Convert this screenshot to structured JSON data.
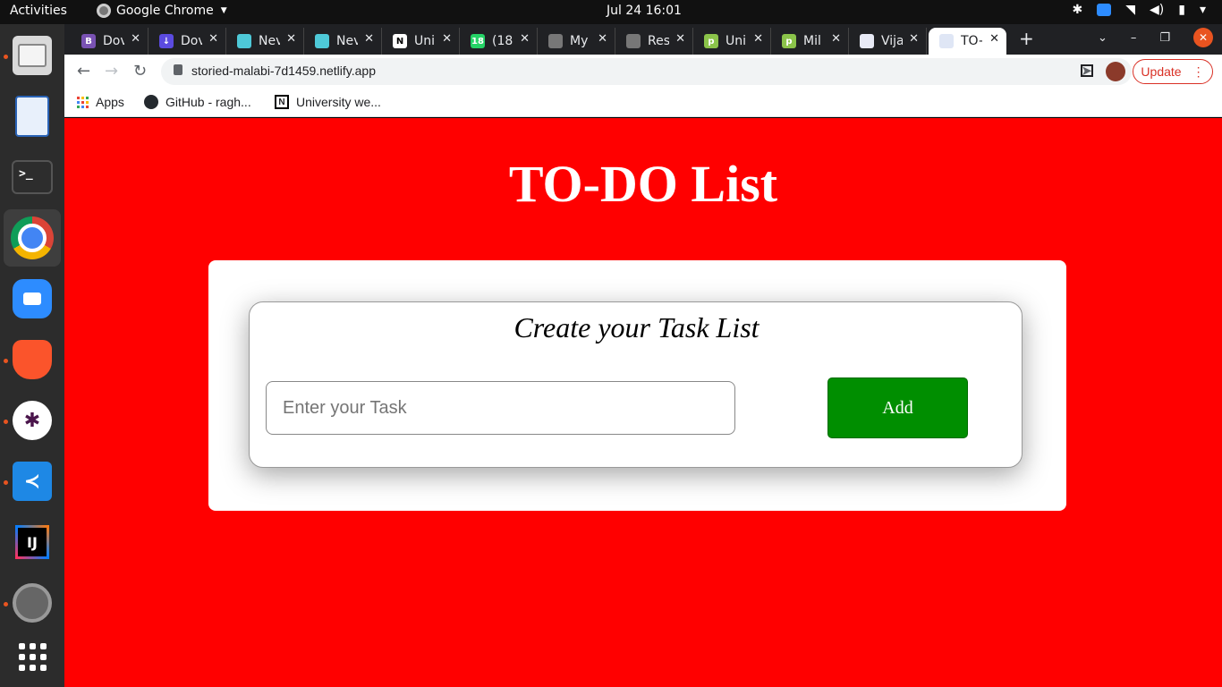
{
  "topbar": {
    "activities": "Activities",
    "app_name": "Google Chrome",
    "clock": "Jul 24  16:01"
  },
  "dock": {
    "items": [
      "files-icon",
      "libreoffice-writer-icon",
      "terminal-icon",
      "chrome-icon",
      "zoom-icon",
      "brave-icon",
      "slack-icon",
      "vscode-icon",
      "intellij-icon",
      "settings-icon",
      "show-apps-icon"
    ],
    "terminal_glyph": ">_",
    "intellij_glyph": "IJ"
  },
  "tabs": [
    {
      "title": "Dov",
      "favicon": "bootstrap-icon",
      "color": "#7952b3",
      "glyph": "B"
    },
    {
      "title": "Dov",
      "favicon": "download-icon",
      "color": "#5b4be0",
      "glyph": "↓"
    },
    {
      "title": "Nev",
      "favicon": "brand-icon",
      "color": "#4ec9d8",
      "glyph": ""
    },
    {
      "title": "Nev",
      "favicon": "brand-icon",
      "color": "#4ec9d8",
      "glyph": ""
    },
    {
      "title": "Uni",
      "favicon": "notion-icon",
      "color": "#ffffff",
      "glyph": "N"
    },
    {
      "title": "(18)",
      "favicon": "whatsapp-icon",
      "color": "#25d366",
      "glyph": "18"
    },
    {
      "title": "My",
      "favicon": "globe-icon",
      "color": "#777777",
      "glyph": ""
    },
    {
      "title": "Res",
      "favicon": "globe-icon",
      "color": "#777777",
      "glyph": ""
    },
    {
      "title": "Uni",
      "favicon": "p-icon",
      "color": "#8bc34a",
      "glyph": "p"
    },
    {
      "title": "Mil",
      "favicon": "p-icon",
      "color": "#8bc34a",
      "glyph": "p"
    },
    {
      "title": "Vija",
      "favicon": "lock-badge-icon",
      "color": "#e8eaf6",
      "glyph": ""
    },
    {
      "title": "TO-",
      "favicon": "document-icon",
      "color": "#dfe6f5",
      "glyph": "",
      "active": true
    }
  ],
  "toolbar": {
    "url": "storied-malabi-7d1459.netlify.app",
    "update_label": "Update"
  },
  "bookmarks": [
    {
      "label": "Apps",
      "icon": "apps-grid-icon"
    },
    {
      "label": "GitHub - ragh...",
      "icon": "github-icon"
    },
    {
      "label": "University we...",
      "icon": "notion-icon"
    }
  ],
  "page": {
    "title": "TO-DO List",
    "subtitle": "Create your Task List",
    "input_placeholder": "Enter your Task",
    "input_value": "",
    "add_label": "Add",
    "colors": {
      "background": "#ff0000",
      "button": "#008e00"
    }
  }
}
